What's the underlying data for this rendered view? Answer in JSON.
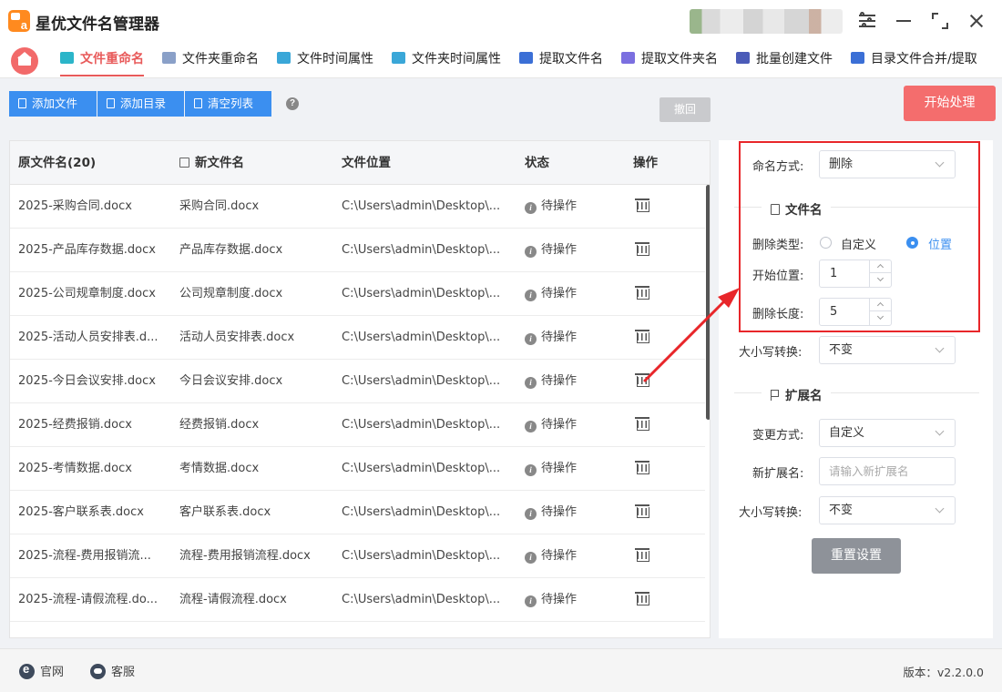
{
  "app": {
    "title": "星优文件名管理器"
  },
  "tabs": [
    {
      "label": "文件重命名",
      "active": true,
      "icon": "rename-icon",
      "color": "#2bb5c9"
    },
    {
      "label": "文件夹重命名",
      "active": false,
      "icon": "folder-rename-icon",
      "color": "#8aa0c8"
    },
    {
      "label": "文件时间属性",
      "active": false,
      "icon": "file-time-icon",
      "color": "#3aa7d8"
    },
    {
      "label": "文件夹时间属性",
      "active": false,
      "icon": "folder-time-icon",
      "color": "#3aa7d8"
    },
    {
      "label": "提取文件名",
      "active": false,
      "icon": "extract-file-icon",
      "color": "#3b6fd6"
    },
    {
      "label": "提取文件夹名",
      "active": false,
      "icon": "extract-folder-icon",
      "color": "#7b6fe0"
    },
    {
      "label": "批量创建文件",
      "active": false,
      "icon": "batch-create-icon",
      "color": "#4b5bb8"
    },
    {
      "label": "目录文件合并/提取",
      "active": false,
      "icon": "merge-icon",
      "color": "#3b6fd6"
    }
  ],
  "toolbar": {
    "add_file": "添加文件",
    "add_dir": "添加目录",
    "clear_list": "清空列表",
    "undo": "撤回",
    "start": "开始处理"
  },
  "table": {
    "headers": {
      "original": "原文件名(20)",
      "new_name": "新文件名",
      "location": "文件位置",
      "status": "状态",
      "action": "操作"
    },
    "rows": [
      {
        "original": "2025-采购合同.docx",
        "new_name": "采购合同.docx",
        "location": "C:\\Users\\admin\\Desktop\\...",
        "status": "待操作"
      },
      {
        "original": "2025-产品库存数据.docx",
        "new_name": "产品库存数据.docx",
        "location": "C:\\Users\\admin\\Desktop\\...",
        "status": "待操作"
      },
      {
        "original": "2025-公司规章制度.docx",
        "new_name": "公司规章制度.docx",
        "location": "C:\\Users\\admin\\Desktop\\...",
        "status": "待操作"
      },
      {
        "original": "2025-活动人员安排表.d...",
        "new_name": "活动人员安排表.docx",
        "location": "C:\\Users\\admin\\Desktop\\...",
        "status": "待操作"
      },
      {
        "original": "2025-今日会议安排.docx",
        "new_name": "今日会议安排.docx",
        "location": "C:\\Users\\admin\\Desktop\\...",
        "status": "待操作"
      },
      {
        "original": "2025-经费报销.docx",
        "new_name": "经费报销.docx",
        "location": "C:\\Users\\admin\\Desktop\\...",
        "status": "待操作"
      },
      {
        "original": "2025-考情数据.docx",
        "new_name": "考情数据.docx",
        "location": "C:\\Users\\admin\\Desktop\\...",
        "status": "待操作"
      },
      {
        "original": "2025-客户联系表.docx",
        "new_name": "客户联系表.docx",
        "location": "C:\\Users\\admin\\Desktop\\...",
        "status": "待操作"
      },
      {
        "original": "2025-流程-费用报销流...",
        "new_name": "流程-费用报销流程.docx",
        "location": "C:\\Users\\admin\\Desktop\\...",
        "status": "待操作"
      },
      {
        "original": "2025-流程-请假流程.do...",
        "new_name": "流程-请假流程.docx",
        "location": "C:\\Users\\admin\\Desktop\\...",
        "status": "待操作"
      }
    ]
  },
  "settings": {
    "naming_mode_label": "命名方式:",
    "naming_mode_value": "删除",
    "filename_section": "文件名",
    "delete_type_label": "删除类型:",
    "delete_type_options": [
      "自定义",
      "位置"
    ],
    "delete_type_selected": "位置",
    "start_pos_label": "开始位置:",
    "start_pos_value": "1",
    "delete_len_label": "删除长度:",
    "delete_len_value": "5",
    "case_label": "大小写转换:",
    "case_value": "不变",
    "ext_section": "扩展名",
    "ext_mode_label": "变更方式:",
    "ext_mode_value": "自定义",
    "new_ext_label": "新扩展名:",
    "new_ext_placeholder": "请输入新扩展名",
    "ext_case_label": "大小写转换:",
    "ext_case_value": "不变",
    "reset": "重置设置"
  },
  "footer": {
    "website": "官网",
    "support": "客服",
    "version": "版本：v2.2.0.0"
  },
  "colors": {
    "accent_red": "#f46d6d",
    "primary_blue": "#3b8ff0",
    "highlight_box": "#e8262a"
  }
}
